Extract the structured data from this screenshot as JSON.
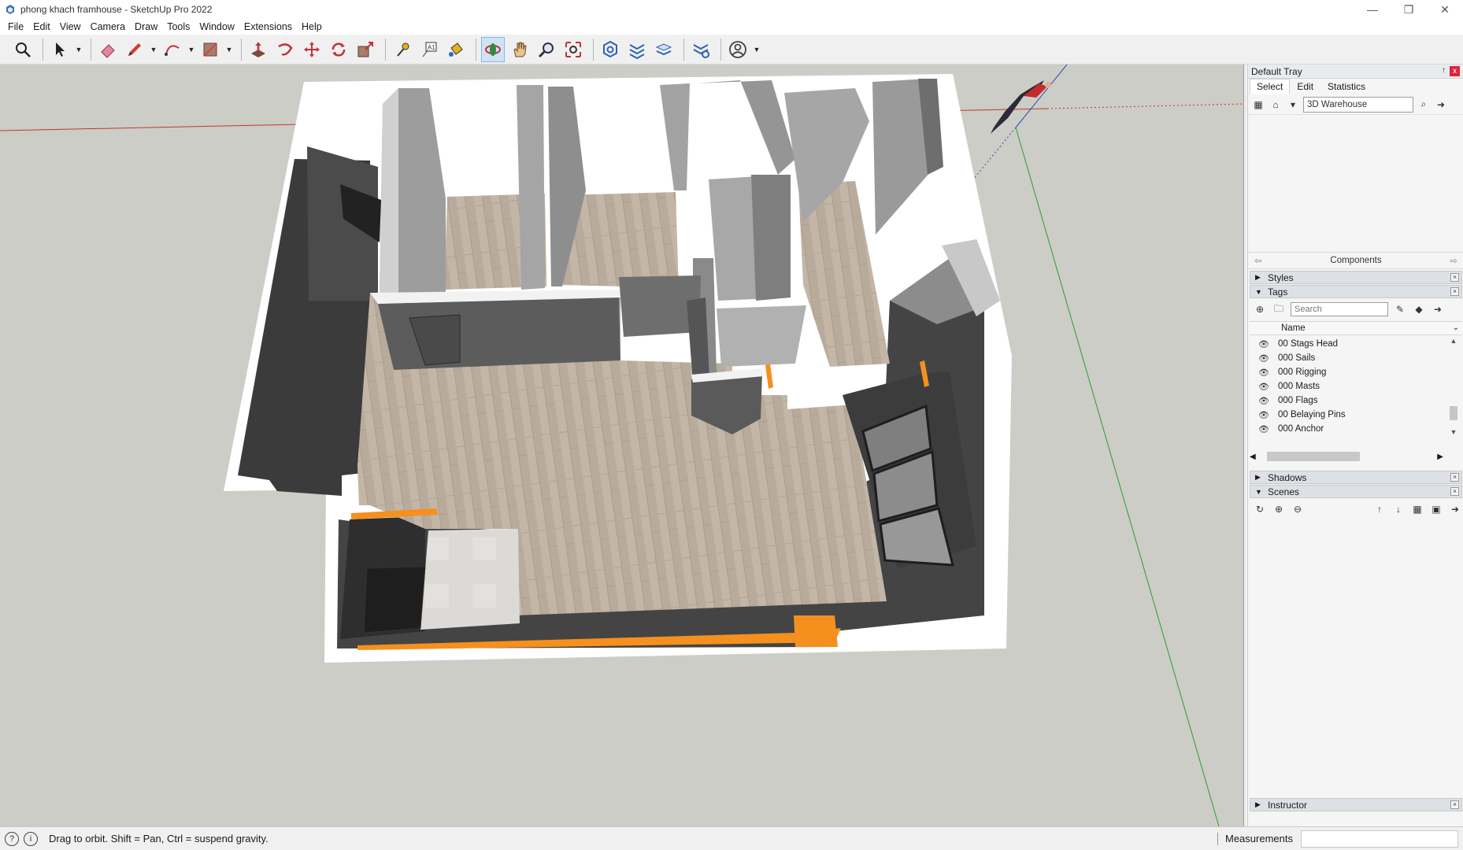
{
  "window": {
    "title": "phong khach framhouse - SketchUp Pro 2022",
    "controls": {
      "minimize": "—",
      "restore": "❐",
      "close": "✕"
    }
  },
  "menu": {
    "items": [
      {
        "id": "file",
        "label": "File"
      },
      {
        "id": "edit",
        "label": "Edit"
      },
      {
        "id": "view",
        "label": "View"
      },
      {
        "id": "camera",
        "label": "Camera"
      },
      {
        "id": "draw",
        "label": "Draw"
      },
      {
        "id": "tools",
        "label": "Tools"
      },
      {
        "id": "window",
        "label": "Window"
      },
      {
        "id": "extensions",
        "label": "Extensions"
      },
      {
        "id": "help",
        "label": "Help"
      }
    ]
  },
  "toolbar": {
    "active_tool": "orbit-tool",
    "tools": [
      "search",
      "select",
      "eraser",
      "line",
      "arc",
      "shape",
      "push-pull",
      "follow-me",
      "move",
      "rotate",
      "scale",
      "tape-measure",
      "text",
      "paint-bucket",
      "orbit",
      "pan",
      "zoom",
      "zoom-extents",
      "warehouse",
      "extension-warehouse",
      "layout",
      "style-builder",
      "account"
    ]
  },
  "tray": {
    "title": "Default Tray",
    "pin": "↑",
    "close": "x",
    "tabs": [
      {
        "label": "Select",
        "active": true
      },
      {
        "label": "Edit",
        "active": false
      },
      {
        "label": "Statistics",
        "active": false
      }
    ],
    "warehouse_search_value": "3D Warehouse",
    "components_label": "Components",
    "sections": {
      "styles": "Styles",
      "tags": "Tags",
      "shadows": "Shadows",
      "scenes": "Scenes",
      "instructor": "Instructor"
    },
    "tags_search_placeholder": "Search",
    "tags_column_name": "Name",
    "tags": [
      {
        "name": "00 Stags Head",
        "visible": true
      },
      {
        "name": "000 Sails",
        "visible": true
      },
      {
        "name": "000 Rigging",
        "visible": true
      },
      {
        "name": "000 Masts",
        "visible": true
      },
      {
        "name": "000 Flags",
        "visible": true
      },
      {
        "name": "00 Belaying Pins",
        "visible": true
      },
      {
        "name": "000 Anchor",
        "visible": true
      }
    ]
  },
  "statusbar": {
    "message": "Drag to orbit. Shift = Pan, Ctrl = suspend gravity.",
    "measurements_label": "Measurements",
    "measurements_value": ""
  },
  "colors": {
    "viewport_bg": "#cccdc6",
    "floor_wood": "#b8aa9a",
    "wall_dark": "#565656",
    "wall_light": "#a9a9a9",
    "wall_top": "#ffffff",
    "accent_orange": "#f5901e",
    "axis_red": "#c0392b",
    "axis_green": "#2e9d2e",
    "axis_blue": "#2c4fb3"
  }
}
